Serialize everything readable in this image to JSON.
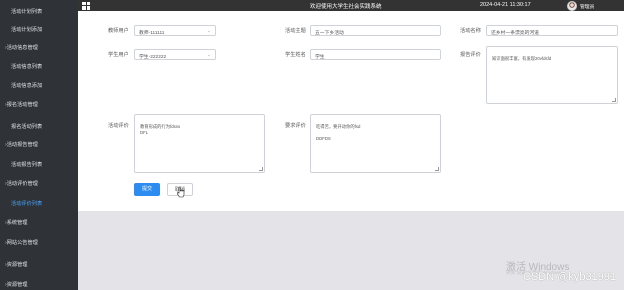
{
  "sidebar": {
    "items": [
      {
        "label": "活动计划列表",
        "active": false,
        "arrow": false
      },
      {
        "label": "活动计划添加",
        "active": false,
        "arrow": false
      },
      {
        "label": "活动信息管理",
        "active": false,
        "arrow": true
      },
      {
        "label": "活动信息列表",
        "active": false,
        "arrow": false
      },
      {
        "label": "活动信息添加",
        "active": false,
        "arrow": false
      },
      {
        "label": "报名活动管理",
        "active": false,
        "arrow": true
      },
      {
        "label": "报名活动列表",
        "active": false,
        "arrow": false
      },
      {
        "label": "活动报告管理",
        "active": false,
        "arrow": true
      },
      {
        "label": "活动报告列表",
        "active": false,
        "arrow": false
      },
      {
        "label": "活动评价管理",
        "active": false,
        "arrow": true
      },
      {
        "label": "活动评价列表",
        "active": true,
        "arrow": false
      },
      {
        "label": "系统管理",
        "active": false,
        "arrow": true
      },
      {
        "label": "网站公告管理",
        "active": false,
        "arrow": true
      },
      {
        "label": "资源管理",
        "active": false,
        "arrow": true
      },
      {
        "label": "资源管理",
        "active": false,
        "arrow": true
      }
    ]
  },
  "header": {
    "title": "欢迎使用大学生社会实践系统",
    "datetime": "2024-04-21 11:30:17",
    "user_name": "管理员"
  },
  "form": {
    "teacher_user": {
      "label": "教师用户",
      "value": "教师-111111"
    },
    "activity_theme": {
      "label": "活动主题",
      "value": "五一下乡活动"
    },
    "activity_name": {
      "label": "活动名称",
      "value": "还乡村一条漂亮的河道"
    },
    "student_user": {
      "label": "学生用户",
      "value": "学生-222222"
    },
    "student_name": {
      "label": "学生姓名",
      "value": "学生"
    },
    "report_review": {
      "label": "报告评价",
      "value": "知识面很丰富，有发现20vfdsfd"
    },
    "mutual_review": {
      "label": "活动评价",
      "value": "教育形成的行为fdsss\nDFL"
    },
    "improvement": {
      "label": "要求评价",
      "value": "吃得苦，要开动你的fsd\n\nDDFDS"
    },
    "submit_label": "提交",
    "cancel_label": "取消"
  },
  "watermark": {
    "line1": "激活 Windows",
    "line2": "转到“设置”以激活 Windows。",
    "csdn": "CSDN @kyb31991"
  },
  "colors": {
    "sidebar_bg": "#2f3337",
    "topbar_bg": "#333333",
    "active_item": "#4aa3ff",
    "primary_button": "#2d8cf0"
  }
}
